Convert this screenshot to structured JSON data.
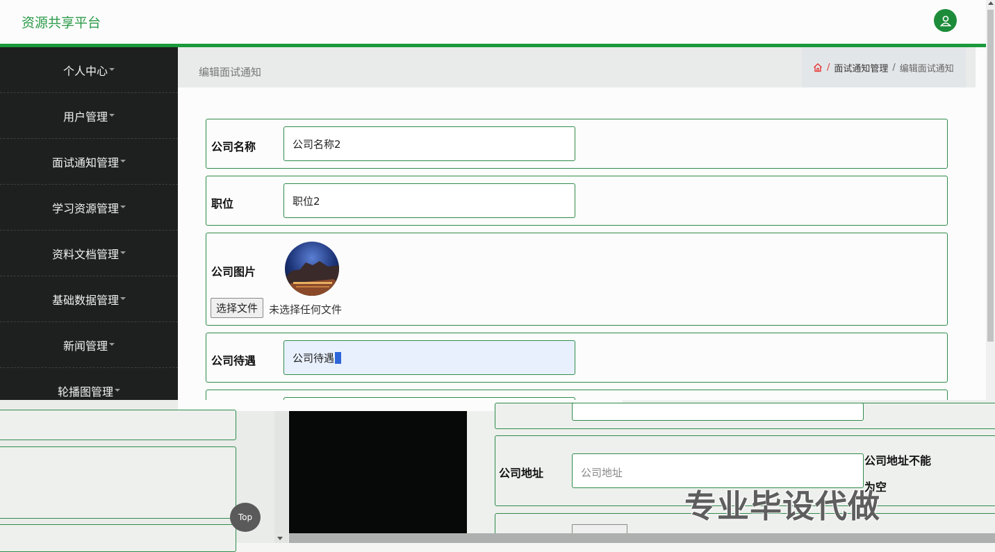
{
  "header": {
    "brand": "资源共享平台"
  },
  "sidebar": {
    "items": [
      {
        "label": "个人中心"
      },
      {
        "label": "用户管理"
      },
      {
        "label": "面试通知管理"
      },
      {
        "label": "学习资源管理"
      },
      {
        "label": "资料文档管理"
      },
      {
        "label": "基础数据管理"
      },
      {
        "label": "新闻管理"
      },
      {
        "label": "轮播图管理"
      }
    ]
  },
  "main": {
    "page_title": "编辑面试通知",
    "breadcrumb": {
      "parent": "面试通知管理",
      "current": "编辑面试通知"
    },
    "form": {
      "company_name": {
        "label": "公司名称",
        "value": "公司名称2"
      },
      "position": {
        "label": "职位",
        "value": "职位2"
      },
      "company_image": {
        "label": "公司图片",
        "file_button": "选择文件",
        "file_status": "未选择任何文件"
      },
      "benefits": {
        "label": "公司待遇",
        "value": "公司待遇"
      }
    }
  },
  "overlay": {
    "address_label": "公司地址",
    "address_placeholder": "公司地址",
    "address_error_1": "公司地址不能",
    "address_error_2": "为空",
    "top_button": "Top",
    "watermark": "专业毕设代做"
  },
  "colors": {
    "accent": "#1a9a3c",
    "sidebar_bg": "#1e2020",
    "border_green": "#2e8b4a"
  }
}
